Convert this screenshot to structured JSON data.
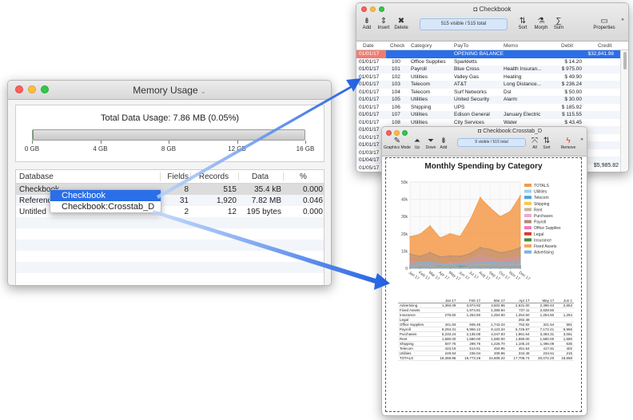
{
  "memory": {
    "title": "Memory Usage",
    "total": "Total Data Usage: 7.86 MB (0.05%)",
    "usage_fraction": 0.0005,
    "gauge_labels": [
      "0 GB",
      "4 GB",
      "8 GB",
      "12 GB",
      "16 GB"
    ],
    "headers": [
      "Database",
      "Fields",
      "Records",
      "Data",
      "%"
    ],
    "rows": [
      {
        "name": "Checkbook",
        "fields": "8",
        "records": "515",
        "data": "35.4 kB",
        "pct": "0.000"
      },
      {
        "name": "Reference",
        "fields": "31",
        "records": "1,920",
        "data": "7.82 MB",
        "pct": "0.046"
      },
      {
        "name": "Untitled",
        "fields": "2",
        "records": "12",
        "data": "195 bytes",
        "pct": "0.000"
      }
    ],
    "context_menu": [
      "Checkbook",
      "Checkbook:Crosstab_D"
    ]
  },
  "checkbook": {
    "title": "Checkbook",
    "toolbar": {
      "add": "Add",
      "insert": "Insert",
      "delete": "Delete",
      "sort": "Sort",
      "morph": "Morph",
      "sum": "Sum",
      "properties": "Properties"
    },
    "status": "515 visible / 515 total",
    "headers": [
      "Date",
      "Check",
      "Category",
      "PayTo",
      "Memo",
      "Debit",
      "Credit"
    ],
    "rows": [
      [
        "01/01/17",
        "",
        "",
        "OPENING BALANCE",
        "",
        "",
        "$32,841.98"
      ],
      [
        "01/01/17",
        "100",
        "Office Supplies",
        "Sparkletts",
        "",
        "$ 14.20",
        ""
      ],
      [
        "01/01/17",
        "101",
        "Payroll",
        "Blue Cross",
        "Health Insuran...",
        "$ 975.00",
        ""
      ],
      [
        "01/01/17",
        "102",
        "Utilities",
        "Valley Gas",
        "Heating",
        "$ 49.90",
        ""
      ],
      [
        "01/01/17",
        "103",
        "Telecom",
        "AT&T",
        "Long Distance...",
        "$ 236.24",
        ""
      ],
      [
        "01/01/17",
        "104",
        "Telecom",
        "Surf Networks",
        "Dsl",
        "$ 50.00",
        ""
      ],
      [
        "01/01/17",
        "105",
        "Utilities",
        "United Security",
        "Alarm",
        "$ 30.00",
        ""
      ],
      [
        "01/01/17",
        "106",
        "Shipping",
        "UPS",
        "",
        "$ 185.92",
        ""
      ],
      [
        "01/01/17",
        "107",
        "Utilities",
        "Edison General",
        "January Electric",
        "$ 115.55",
        ""
      ],
      [
        "01/01/17",
        "108",
        "Utilities",
        "City Services",
        "Water",
        "$ 43.45",
        ""
      ],
      [
        "01/01/17",
        "109",
        "Rent",
        "Pacific Properties",
        "January Rent",
        "$ 1,580.00",
        ""
      ],
      [
        "01/01/17",
        "",
        "",
        "",
        "",
        "",
        ""
      ],
      [
        "01/01/17",
        "",
        "",
        "",
        "",
        "",
        ""
      ],
      [
        "01/03/17",
        "",
        "",
        "",
        "",
        "",
        ""
      ],
      [
        "01/04/17",
        "",
        "",
        "",
        "",
        "",
        ""
      ],
      [
        "01/05/17",
        "",
        "",
        "",
        "",
        "",
        ""
      ]
    ],
    "footer_credit": "$5,985.82"
  },
  "crosstab": {
    "title": "Checkbook:Crosstab_D",
    "toolbar": {
      "graphics": "Graphics Mode",
      "up": "Up",
      "down": "Down",
      "add": "Add",
      "all": "All",
      "sort": "Sort",
      "remove": "Remove"
    },
    "status": "9 visible / 515 total",
    "table_headers": [
      "",
      "Jan 17",
      "Feb 17",
      "Mar 17",
      "Apr 17",
      "May 17",
      "Jun 1"
    ],
    "table_rows": [
      [
        "Advertising",
        "1,360.09",
        "3,874.92",
        "3,602.86",
        "2,631.00",
        "2,396.43",
        "2,653"
      ],
      [
        "Fixed Assets",
        "",
        "1,974.81",
        "1,365.94",
        "737.11",
        "2,828.50",
        ""
      ],
      [
        "Insurance",
        "276.60",
        "1,254.50",
        "1,254.50",
        "1,254.50",
        "1,254.50",
        "1,254"
      ],
      [
        "Legal",
        "",
        "",
        "",
        "282.48",
        "",
        ""
      ],
      [
        "Office Supplies",
        "441.83",
        "936.45",
        "1,743.34",
        "752.82",
        "321.54",
        "581"
      ],
      [
        "Payroll",
        "8,294.31",
        "6,966.12",
        "9,123.34",
        "6,726.87",
        "7,172.41",
        "6,966"
      ],
      [
        "Purchases",
        "5,233.24",
        "2,135.08",
        "4,047.93",
        "1,961.64",
        "3,393.31",
        "3,061"
      ],
      [
        "Rent",
        "1,580.00",
        "1,580.00",
        "1,580.00",
        "1,580.00",
        "1,580.00",
        "1,580"
      ],
      [
        "Shipping",
        "507.75",
        "298.75",
        "1,226.70",
        "1,106.24",
        "1,486.09",
        "635"
      ],
      [
        "Telecom",
        "423.19",
        "514.81",
        "454.95",
        "451.64",
        "417.81",
        "402"
      ],
      [
        "Utilities",
        "249.84",
        "236.04",
        "208.96",
        "234.48",
        "234.61",
        "215"
      ],
      [
        "TOTALS",
        "18,368.85",
        "19,773.28",
        "24,608.22",
        "17,708.74",
        "20,072.20",
        "18,558"
      ]
    ]
  },
  "chart_data": {
    "type": "area",
    "title": "Monthly Spending by Category",
    "categories": [
      "Jan 17",
      "Feb 17",
      "Mar 17",
      "Apr 17",
      "May 17",
      "Jun 17",
      "Jul 17",
      "Aug 17",
      "Sep 17",
      "Oct 17",
      "Nov 17",
      "Dec 17"
    ],
    "ylim": [
      0,
      50000
    ],
    "yticks": [
      "0",
      "10k",
      "20k",
      "30k",
      "40k",
      "50k"
    ],
    "legend_position": "right",
    "series": [
      {
        "name": "TOTALS",
        "color": "#f39a4a",
        "values": [
          18369,
          19773,
          24608,
          17709,
          20072,
          18558,
          28000,
          41000,
          35000,
          30000,
          33000,
          42000
        ]
      },
      {
        "name": "Utilities",
        "color": "#9fd0f3",
        "values": [
          250,
          236,
          209,
          234,
          235,
          215,
          230,
          240,
          250,
          230,
          240,
          260
        ]
      },
      {
        "name": "Telecom",
        "color": "#4ba3d8",
        "values": [
          423,
          515,
          455,
          452,
          418,
          402,
          430,
          440,
          450,
          420,
          430,
          460
        ]
      },
      {
        "name": "Shipping",
        "color": "#f6c64c",
        "values": [
          508,
          299,
          1227,
          1106,
          1486,
          635,
          900,
          1100,
          900,
          800,
          1000,
          1200
        ]
      },
      {
        "name": "Rent",
        "color": "#c9b49a",
        "values": [
          1580,
          1580,
          1580,
          1580,
          1580,
          1580,
          1580,
          1580,
          1580,
          1580,
          1580,
          1580
        ]
      },
      {
        "name": "Purchases",
        "color": "#f0a6cf",
        "values": [
          5233,
          2135,
          4048,
          1962,
          3393,
          3061,
          5000,
          8000,
          6000,
          5000,
          6000,
          7000
        ]
      },
      {
        "name": "Payroll",
        "color": "#b08a78",
        "values": [
          8294,
          6966,
          9123,
          6727,
          7172,
          6966,
          8500,
          12000,
          11000,
          9000,
          10000,
          12000
        ]
      },
      {
        "name": "Office Supplies",
        "color": "#e77ac2",
        "values": [
          442,
          936,
          1743,
          753,
          322,
          581,
          800,
          1200,
          900,
          700,
          900,
          1100
        ]
      },
      {
        "name": "Legal",
        "color": "#d9392f",
        "values": [
          0,
          0,
          0,
          282,
          0,
          0,
          0,
          0,
          0,
          0,
          0,
          0
        ]
      },
      {
        "name": "Insurance",
        "color": "#4a8a3c",
        "values": [
          277,
          1255,
          1255,
          1255,
          1255,
          1254,
          1255,
          1255,
          1255,
          1255,
          1255,
          1255
        ]
      },
      {
        "name": "Fixed Assets",
        "color": "#f6a35b",
        "values": [
          0,
          1975,
          1366,
          737,
          2829,
          0,
          1500,
          2500,
          1800,
          1500,
          1800,
          2500
        ]
      },
      {
        "name": "Advertising",
        "color": "#7fb2dd",
        "values": [
          1360,
          3875,
          3603,
          2631,
          2396,
          2653,
          3000,
          4000,
          3500,
          3200,
          3400,
          4200
        ]
      }
    ]
  }
}
